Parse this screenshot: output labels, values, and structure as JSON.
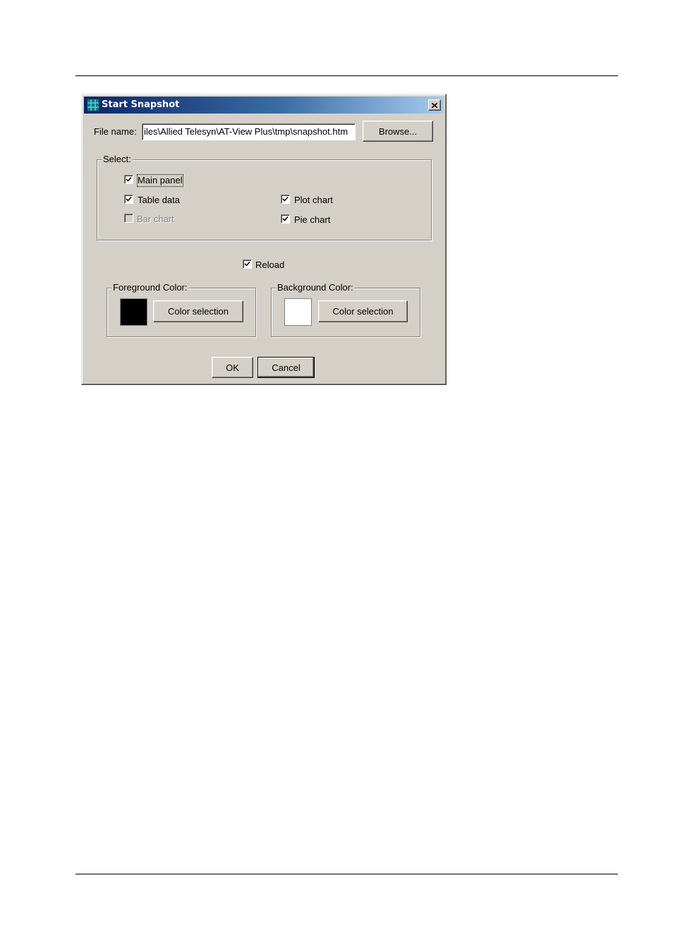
{
  "dialog": {
    "title": "Start Snapshot",
    "app_icon": "grid-icon",
    "close_icon": "close-icon"
  },
  "file": {
    "label": "File name:",
    "value": "iles\\Allied Telesyn\\AT-View Plus\\tmp\\snapshot.htm",
    "browse_label": "Browse..."
  },
  "select_group": {
    "legend": "Select:",
    "options": [
      {
        "label": "Main panel",
        "checked": true,
        "enabled": true
      },
      {
        "label": "Table data",
        "checked": true,
        "enabled": true
      },
      {
        "label": "Bar chart",
        "checked": false,
        "enabled": false
      },
      {
        "label": "Plot chart",
        "checked": true,
        "enabled": true
      },
      {
        "label": "Pie chart",
        "checked": true,
        "enabled": true
      }
    ]
  },
  "reload": {
    "label": "Reload",
    "checked": true
  },
  "foreground": {
    "legend": "Foreground Color:",
    "color": "#000000",
    "button_label": "Color selection"
  },
  "background": {
    "legend": "Background Color:",
    "color": "#ffffff",
    "button_label": "Color selection"
  },
  "buttons": {
    "ok": "OK",
    "cancel": "Cancel"
  },
  "colors": {
    "dialog_face": "#d4d0c8",
    "title_start": "#0a246a",
    "title_end": "#a6caf0"
  }
}
